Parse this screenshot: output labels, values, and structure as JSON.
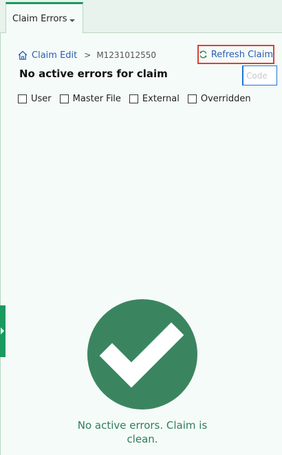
{
  "tab": {
    "label": "Claim Errors"
  },
  "breadcrumb": {
    "link_label": "Claim Edit",
    "separator": ">",
    "current": "M1231012550"
  },
  "toolbar": {
    "refresh_label": "Refresh Claim"
  },
  "heading": "No active errors for claim",
  "code_filter": {
    "placeholder": "Code",
    "value": ""
  },
  "filters": [
    {
      "label": "User",
      "checked": false
    },
    {
      "label": "Master File",
      "checked": false
    },
    {
      "label": "External",
      "checked": false
    },
    {
      "label": "Overridden",
      "checked": false
    }
  ],
  "status": {
    "message": "No active errors. Claim is clean.",
    "icon": "checkmark-circle-icon"
  },
  "colors": {
    "accent": "#1a9a5c",
    "success": "#3a8560",
    "link": "#2a5db0",
    "highlight_border": "#e03c3c"
  }
}
